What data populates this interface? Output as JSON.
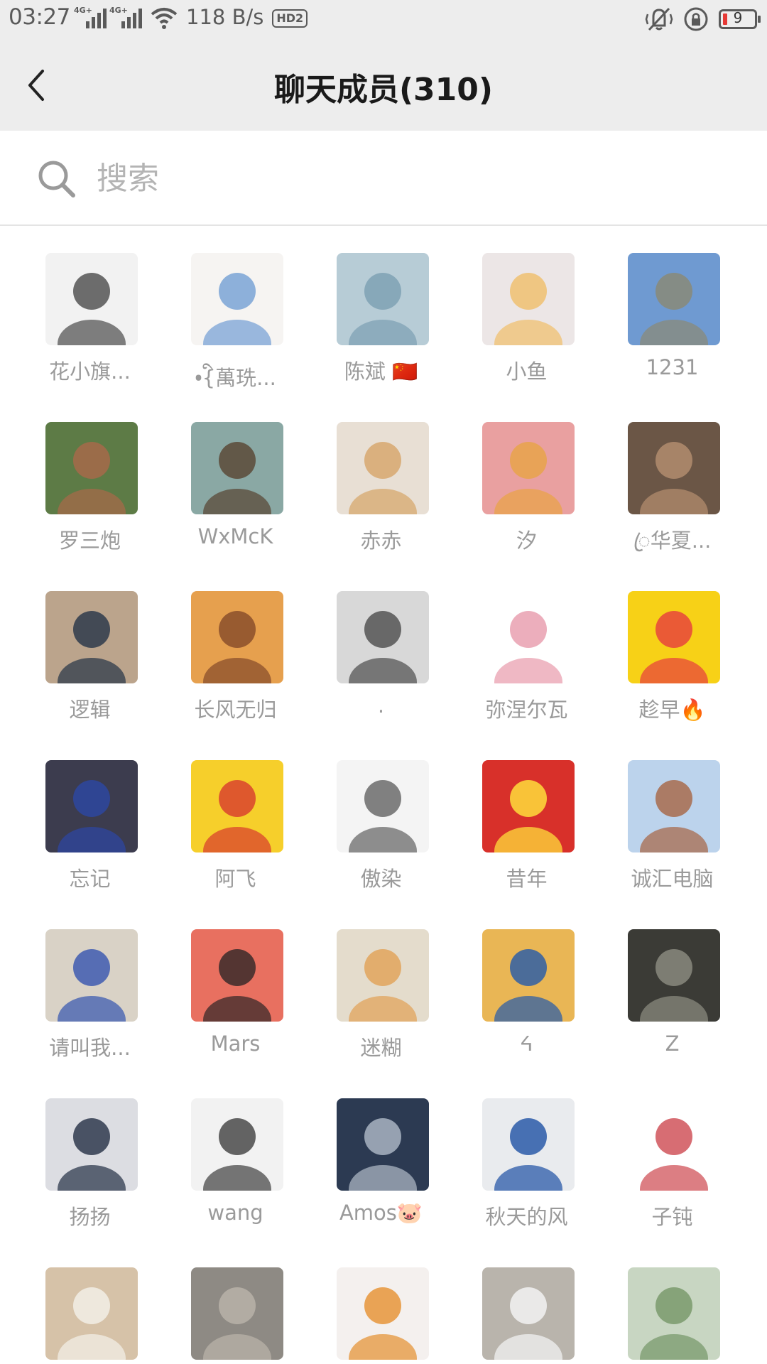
{
  "status_bar": {
    "time": "03:27",
    "sim1": "4G+",
    "sim2": "4G+",
    "speed": "118 B/s",
    "hd": "HD2",
    "battery": "9",
    "battery_color": "#e53935"
  },
  "header": {
    "title": "聊天成员(310)",
    "back_icon": "chevron-left-icon"
  },
  "search": {
    "placeholder": "搜索",
    "value": "",
    "icon": "search-icon"
  },
  "members": [
    {
      "name": "花小旗...",
      "colors": [
        "#f2f2f2",
        "#555555"
      ]
    },
    {
      "name": "•ི{萬珗...",
      "colors": [
        "#f6f4f2",
        "#7aa3d6"
      ]
    },
    {
      "name": "陈斌 🇨🇳",
      "colors": [
        "#b7ccd6",
        "#7fa1b4"
      ]
    },
    {
      "name": "小鱼",
      "colors": [
        "#ece6e6",
        "#f0c070"
      ]
    },
    {
      "name": "1231",
      "colors": [
        "#6f9ad1",
        "#8a8a78"
      ]
    },
    {
      "name": "罗三炮",
      "colors": [
        "#5d7b46",
        "#a66a4a"
      ]
    },
    {
      "name": "WxMcK",
      "colors": [
        "#8aa8a4",
        "#5a4a38"
      ]
    },
    {
      "name": "赤赤",
      "colors": [
        "#e8dfd4",
        "#d7a86e"
      ]
    },
    {
      "name": "汐",
      "colors": [
        "#e9a0a0",
        "#e8a34a"
      ]
    },
    {
      "name": "ꦿ华夏...",
      "colors": [
        "#6b5646",
        "#b28c6e"
      ]
    },
    {
      "name": "逻辑",
      "colors": [
        "#bba48c",
        "#2e3b4b"
      ]
    },
    {
      "name": "长风无归",
      "colors": [
        "#e6a04e",
        "#8a4f2c"
      ]
    },
    {
      "name": ".",
      "colors": [
        "#d8d8d8",
        "#555555"
      ]
    },
    {
      "name": "弥涅尔瓦",
      "colors": [
        "#ffffff",
        "#e9a0b0"
      ]
    },
    {
      "name": "趁早🔥",
      "colors": [
        "#f7d117",
        "#e8453c"
      ]
    },
    {
      "name": "忘记",
      "colors": [
        "#3c3c4e",
        "#2d46a0"
      ]
    },
    {
      "name": "阿飞",
      "colors": [
        "#f6cf2b",
        "#d9432e"
      ]
    },
    {
      "name": "傲染",
      "colors": [
        "#f4f4f4",
        "#6b6b6b"
      ]
    },
    {
      "name": "昔年",
      "colors": [
        "#d8302a",
        "#ffdd3b"
      ]
    },
    {
      "name": "诚汇电脑",
      "colors": [
        "#bcd3ec",
        "#a86b4d"
      ]
    },
    {
      "name": "请叫我...",
      "colors": [
        "#d9d2c6",
        "#3e5cb0"
      ]
    },
    {
      "name": "Mars",
      "colors": [
        "#e87060",
        "#3a2a2a"
      ]
    },
    {
      "name": "迷糊",
      "colors": [
        "#e4dccc",
        "#e2a45c"
      ]
    },
    {
      "name": "ᔦ",
      "colors": [
        "#e9b655",
        "#2f5fa6"
      ]
    },
    {
      "name": "Z",
      "colors": [
        "#3b3b36",
        "#8a8a7e"
      ]
    },
    {
      "name": "扬扬",
      "colors": [
        "#dcdde2",
        "#2f3a4e"
      ]
    },
    {
      "name": "wang",
      "colors": [
        "#f2f2f2",
        "#4a4a4a"
      ]
    },
    {
      "name": "Amos🐷",
      "colors": [
        "#2c3a52",
        "#a9b4c2"
      ]
    },
    {
      "name": "秋天的风",
      "colors": [
        "#e9ebee",
        "#2a5aa8"
      ]
    },
    {
      "name": "子钝",
      "colors": [
        "#ffffff",
        "#d0535a"
      ]
    },
    {
      "name": "",
      "colors": [
        "#d6c2a8",
        "#f2eee6"
      ]
    },
    {
      "name": "",
      "colors": [
        "#8e8a84",
        "#b8b2a8"
      ]
    },
    {
      "name": "",
      "colors": [
        "#f4f0ee",
        "#e6953a"
      ]
    },
    {
      "name": "",
      "colors": [
        "#b9b4ac",
        "#f2f2f2"
      ]
    },
    {
      "name": "",
      "colors": [
        "#c8d6c2",
        "#7a9a6c"
      ]
    }
  ]
}
